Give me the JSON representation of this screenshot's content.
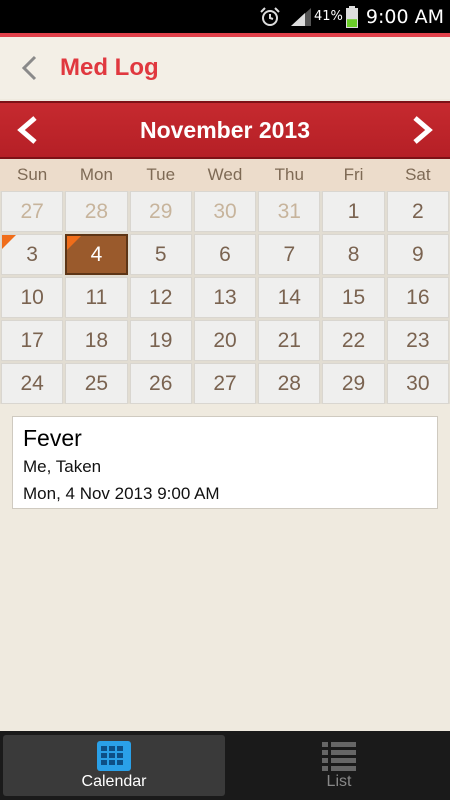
{
  "status": {
    "battery_pct": "41%",
    "time": "9:00 AM",
    "battery_level": 0.41
  },
  "app": {
    "title": "Med Log"
  },
  "calendar": {
    "month_label": "November 2013",
    "weekdays": [
      "Sun",
      "Mon",
      "Tue",
      "Wed",
      "Thu",
      "Fri",
      "Sat"
    ],
    "weeks": [
      [
        {
          "d": "27",
          "dim": true
        },
        {
          "d": "28",
          "dim": true
        },
        {
          "d": "29",
          "dim": true
        },
        {
          "d": "30",
          "dim": true
        },
        {
          "d": "31",
          "dim": true
        },
        {
          "d": "1"
        },
        {
          "d": "2"
        }
      ],
      [
        {
          "d": "3",
          "mark": true
        },
        {
          "d": "4",
          "mark": true,
          "selected": true
        },
        {
          "d": "5"
        },
        {
          "d": "6"
        },
        {
          "d": "7"
        },
        {
          "d": "8"
        },
        {
          "d": "9"
        }
      ],
      [
        {
          "d": "10"
        },
        {
          "d": "11"
        },
        {
          "d": "12"
        },
        {
          "d": "13"
        },
        {
          "d": "14"
        },
        {
          "d": "15"
        },
        {
          "d": "16"
        }
      ],
      [
        {
          "d": "17"
        },
        {
          "d": "18"
        },
        {
          "d": "19"
        },
        {
          "d": "20"
        },
        {
          "d": "21"
        },
        {
          "d": "22"
        },
        {
          "d": "23"
        }
      ],
      [
        {
          "d": "24"
        },
        {
          "d": "25"
        },
        {
          "d": "26"
        },
        {
          "d": "27"
        },
        {
          "d": "28"
        },
        {
          "d": "29"
        },
        {
          "d": "30"
        }
      ]
    ]
  },
  "entry": {
    "title": "Fever",
    "who_status": "Me, Taken",
    "datetime": "Mon, 4 Nov 2013 9:00 AM"
  },
  "tabs": [
    {
      "label": "Calendar",
      "icon": "calendar-grid-icon",
      "active": true
    },
    {
      "label": "List",
      "icon": "list-icon",
      "active": false
    }
  ],
  "colors": {
    "accent_red": "#e0383f",
    "header_red": "#c62a2f",
    "selected_brown": "#9a5a2c",
    "mark_orange": "#f06d1a",
    "calendar_icon_blue": "#2aa0e8"
  }
}
